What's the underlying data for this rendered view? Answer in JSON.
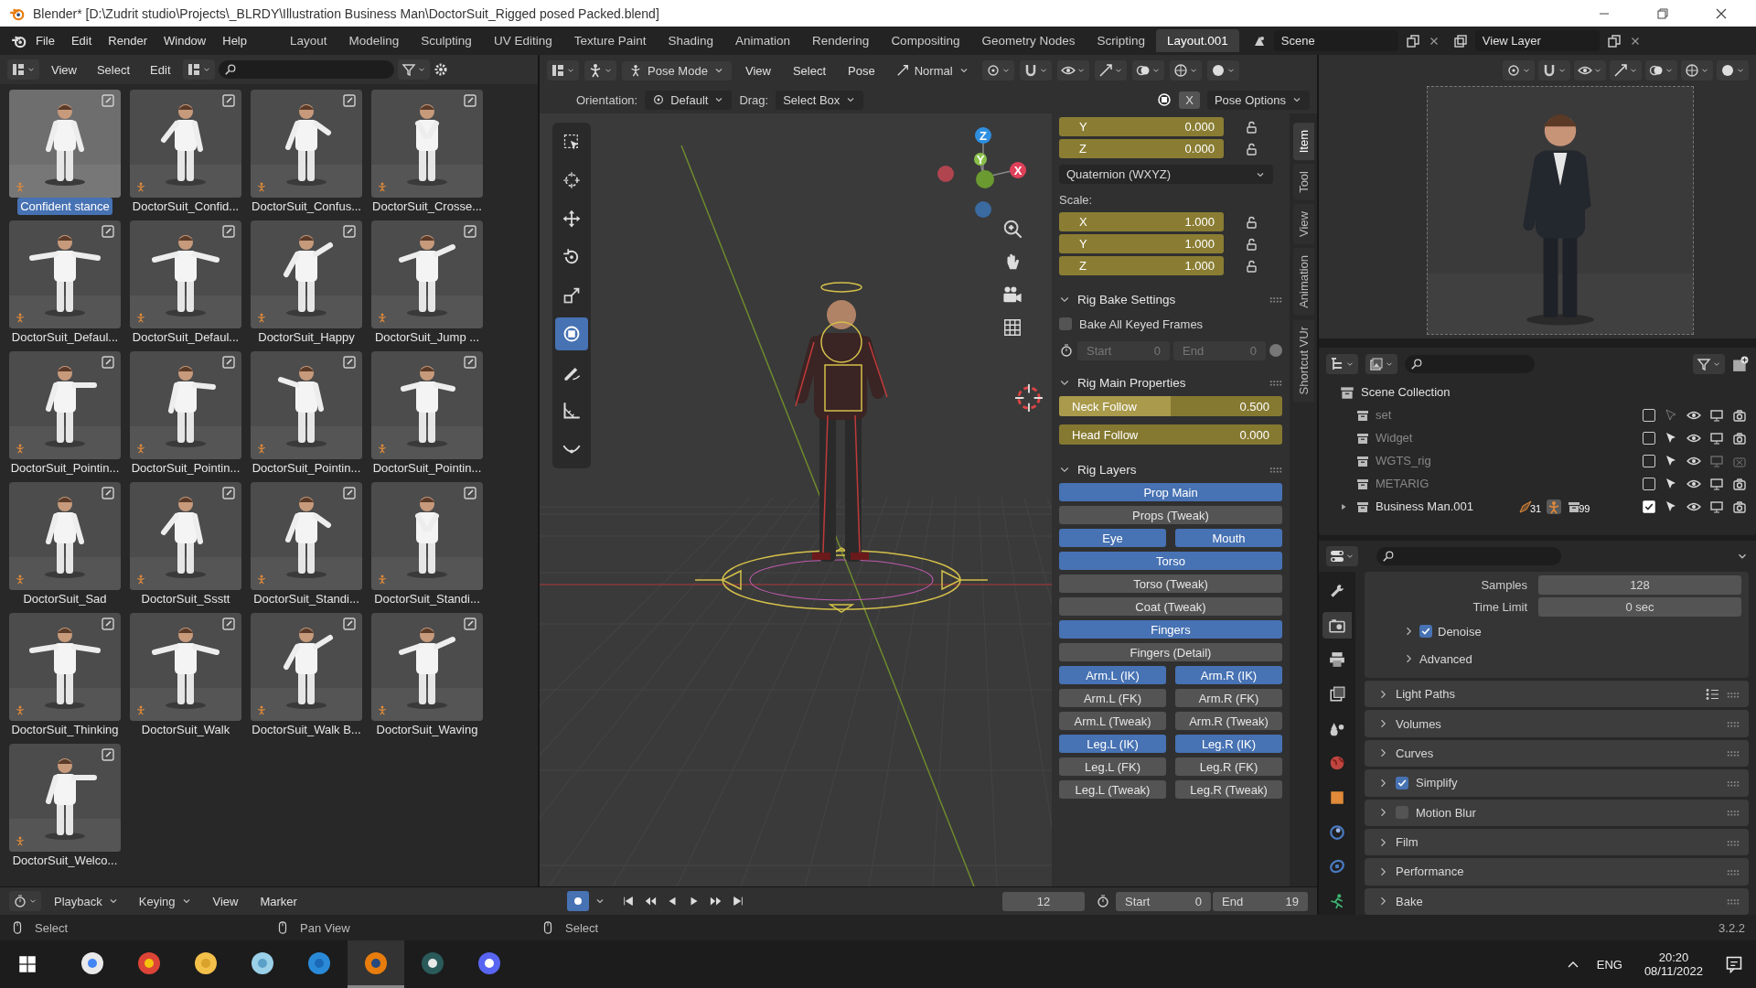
{
  "window": {
    "title": "Blender* [D:\\Zudrit studio\\Projects\\_BLRDY\\Illustration Business Man\\DoctorSuit_Rigged posed Packed.blend]"
  },
  "menu": [
    "File",
    "Edit",
    "Render",
    "Window",
    "Help"
  ],
  "workspaces": [
    {
      "label": "Layout",
      "selected": false
    },
    {
      "label": "Modeling",
      "selected": false
    },
    {
      "label": "Sculpting",
      "selected": false
    },
    {
      "label": "UV Editing",
      "selected": false
    },
    {
      "label": "Texture Paint",
      "selected": false
    },
    {
      "label": "Shading",
      "selected": false
    },
    {
      "label": "Animation",
      "selected": false
    },
    {
      "label": "Rendering",
      "selected": false
    },
    {
      "label": "Compositing",
      "selected": false
    },
    {
      "label": "Geometry Nodes",
      "selected": false
    },
    {
      "label": "Scripting",
      "selected": false
    },
    {
      "label": "Layout.001",
      "selected": true
    }
  ],
  "scene": "Scene",
  "view_layer": "View Layer",
  "asset_browser": {
    "menus": [
      "View",
      "Select",
      "Edit"
    ],
    "assets": [
      {
        "label": "Confident stance",
        "selected": true
      },
      {
        "label": "DoctorSuit_Confid...",
        "selected": false
      },
      {
        "label": "DoctorSuit_Confus...",
        "selected": false
      },
      {
        "label": "DoctorSuit_Crosse...",
        "selected": false
      },
      {
        "label": "DoctorSuit_Defaul...",
        "selected": false
      },
      {
        "label": "DoctorSuit_Defaul...",
        "selected": false
      },
      {
        "label": "DoctorSuit_Happy",
        "selected": false
      },
      {
        "label": "DoctorSuit_Jump ...",
        "selected": false
      },
      {
        "label": "DoctorSuit_Pointin...",
        "selected": false
      },
      {
        "label": "DoctorSuit_Pointin...",
        "selected": false
      },
      {
        "label": "DoctorSuit_Pointin...",
        "selected": false
      },
      {
        "label": "DoctorSuit_Pointin...",
        "selected": false
      },
      {
        "label": "DoctorSuit_Sad",
        "selected": false
      },
      {
        "label": "DoctorSuit_Ssstt",
        "selected": false
      },
      {
        "label": "DoctorSuit_Standi...",
        "selected": false
      },
      {
        "label": "DoctorSuit_Standi...",
        "selected": false
      },
      {
        "label": "DoctorSuit_Thinking",
        "selected": false
      },
      {
        "label": "DoctorSuit_Walk",
        "selected": false
      },
      {
        "label": "DoctorSuit_Walk B...",
        "selected": false
      },
      {
        "label": "DoctorSuit_Waving",
        "selected": false
      },
      {
        "label": "DoctorSuit_Welco...",
        "selected": false
      }
    ]
  },
  "viewport": {
    "mode": "Pose Mode",
    "menus": [
      "View",
      "Select",
      "Pose"
    ],
    "transform_orientation": "Normal",
    "orientation_label": "Orientation:",
    "orientation": "Default",
    "drag_label": "Drag:",
    "drag": "Select Box",
    "mirror": "X",
    "options": "Pose Options",
    "tools": [
      {
        "kind": "select",
        "selected": false
      },
      {
        "kind": "cursor",
        "selected": false
      },
      {
        "kind": "move",
        "selected": false
      },
      {
        "kind": "rotate",
        "selected": false
      },
      {
        "kind": "scale",
        "selected": false
      },
      {
        "kind": "transform",
        "selected": true
      },
      {
        "kind": "annotate",
        "selected": false
      },
      {
        "kind": "measure",
        "selected": false
      },
      {
        "kind": "curve",
        "selected": false
      }
    ],
    "gizmo": {
      "z": "Z",
      "y": "Y",
      "x": "X"
    }
  },
  "sidebar": {
    "tabs": [
      {
        "label": "Item",
        "selected": true
      },
      {
        "label": "Tool",
        "selected": false
      },
      {
        "label": "View",
        "selected": false
      },
      {
        "label": "Animation",
        "selected": false
      },
      {
        "label": "Shortcut VUr",
        "selected": false
      }
    ],
    "rotation": [
      {
        "axis": "Y",
        "value": "0.000"
      },
      {
        "axis": "Z",
        "value": "0.000"
      }
    ],
    "rotation_mode": "Quaternion (WXYZ)",
    "scale_label": "Scale:",
    "scale": [
      {
        "axis": "X",
        "value": "1.000"
      },
      {
        "axis": "Y",
        "value": "1.000"
      },
      {
        "axis": "Z",
        "value": "1.000"
      }
    ],
    "panels": [
      {
        "kind": "bake",
        "title": "Rig Bake Settings",
        "expanded": true,
        "checkbox": {
          "label": "Bake All Keyed Frames",
          "checked": false
        },
        "start_label": "Start",
        "start": "0",
        "end_label": "End",
        "end": "0"
      },
      {
        "kind": "sliders",
        "title": "Rig Main Properties",
        "expanded": true,
        "sliders": [
          {
            "label": "Neck Follow",
            "value": "0.500",
            "level": 0.5
          },
          {
            "label": "Head Follow",
            "value": "0.000",
            "level": 0
          }
        ]
      },
      {
        "kind": "layers",
        "title": "Rig Layers",
        "expanded": true,
        "rows": [
          [
            {
              "label": "Prop Main",
              "selected": true
            }
          ],
          [
            {
              "label": "Props (Tweak)",
              "selected": false
            }
          ],
          [
            {
              "label": "Eye",
              "selected": true
            },
            {
              "label": "Mouth",
              "selected": true
            }
          ],
          [
            {
              "label": "Torso",
              "selected": true
            }
          ],
          [
            {
              "label": "Torso (Tweak)",
              "selected": false
            }
          ],
          [
            {
              "label": "Coat (Tweak)",
              "selected": false
            }
          ],
          [
            {
              "label": "Fingers",
              "selected": true
            }
          ],
          [
            {
              "label": "Fingers (Detail)",
              "selected": false
            }
          ],
          [
            {
              "label": "Arm.L (IK)",
              "selected": true
            },
            {
              "label": "Arm.R (IK)",
              "selected": true
            }
          ],
          [
            {
              "label": "Arm.L (FK)",
              "selected": false
            },
            {
              "label": "Arm.R (FK)",
              "selected": false
            }
          ],
          [
            {
              "label": "Arm.L (Tweak)",
              "selected": false
            },
            {
              "label": "Arm.R (Tweak)",
              "selected": false
            }
          ],
          [
            {
              "label": "Leg.L (IK)",
              "selected": true
            },
            {
              "label": "Leg.R (IK)",
              "selected": true
            }
          ],
          [
            {
              "label": "Leg.L (FK)",
              "selected": false
            },
            {
              "label": "Leg.R (FK)",
              "selected": false
            }
          ],
          [
            {
              "label": "Leg.L (Tweak)",
              "selected": false
            },
            {
              "label": "Leg.R (Tweak)",
              "selected": false
            }
          ]
        ]
      }
    ]
  },
  "outliner": {
    "root": "Scene Collection",
    "items": [
      {
        "name": "set",
        "expandable": false,
        "checked": false,
        "selectable": false,
        "viewport": true,
        "renderable": true
      },
      {
        "name": "Widget",
        "expandable": false,
        "checked": false,
        "selectable": true,
        "viewport": true,
        "renderable": true
      },
      {
        "name": "WGTS_rig",
        "expandable": false,
        "checked": false,
        "selectable": true,
        "viewport": false,
        "renderable": false
      },
      {
        "name": "METARIG",
        "expandable": false,
        "checked": false,
        "selectable": true,
        "viewport": true,
        "renderable": true
      },
      {
        "name": "Business Man.001",
        "expandable": true,
        "checked": true,
        "selectable": true,
        "viewport": true,
        "renderable": true,
        "badges": [
          "31",
          "99"
        ]
      }
    ]
  },
  "properties": {
    "tabs": [
      {
        "kind": "tool",
        "selected": false
      },
      {
        "kind": "render",
        "selected": true
      },
      {
        "kind": "output",
        "selected": false
      },
      {
        "kind": "view_layer",
        "selected": false
      },
      {
        "kind": "scene",
        "selected": false
      },
      {
        "kind": "world",
        "selected": false
      },
      {
        "kind": "object",
        "selected": false
      },
      {
        "kind": "physics",
        "selected": false
      },
      {
        "kind": "constraint",
        "selected": false
      },
      {
        "kind": "data",
        "selected": false
      }
    ],
    "fields": [
      {
        "label": "Samples",
        "value": "128"
      },
      {
        "label": "Time Limit",
        "value": "0 sec"
      }
    ],
    "subpanels": [
      {
        "label": "Denoise",
        "expanded": false,
        "checked": true
      },
      {
        "label": "Advanced",
        "expanded": false
      }
    ],
    "panels": [
      {
        "label": "Light Paths",
        "expanded": false
      },
      {
        "label": "Volumes",
        "expanded": false
      },
      {
        "label": "Curves",
        "expanded": false
      },
      {
        "label": "Simplify",
        "expanded": false,
        "checked": true
      },
      {
        "label": "Motion Blur",
        "expanded": false,
        "checked": false
      },
      {
        "label": "Film",
        "expanded": false
      },
      {
        "label": "Performance",
        "expanded": false
      },
      {
        "label": "Bake",
        "expanded": false
      }
    ]
  },
  "timeline": {
    "menus": [
      "Playback",
      "Keying",
      "View",
      "Marker"
    ],
    "auto_key": true,
    "frame": "12",
    "start_label": "Start",
    "start": "0",
    "end_label": "End",
    "end": "19"
  },
  "status_bar": {
    "hints": [
      "Select",
      "Pan View",
      "Select"
    ],
    "version": "3.2.2"
  },
  "taskbar": {
    "apps": [
      {
        "kind": "search",
        "active": false
      },
      {
        "kind": "browser",
        "active": false
      },
      {
        "kind": "folder",
        "active": false
      },
      {
        "kind": "notes",
        "active": false
      },
      {
        "kind": "code",
        "active": false
      },
      {
        "kind": "blender",
        "active": true
      },
      {
        "kind": "terminal",
        "active": false
      },
      {
        "kind": "chat",
        "active": false
      }
    ],
    "language": "ENG",
    "time": "20:20",
    "date": "08/11/2022"
  }
}
